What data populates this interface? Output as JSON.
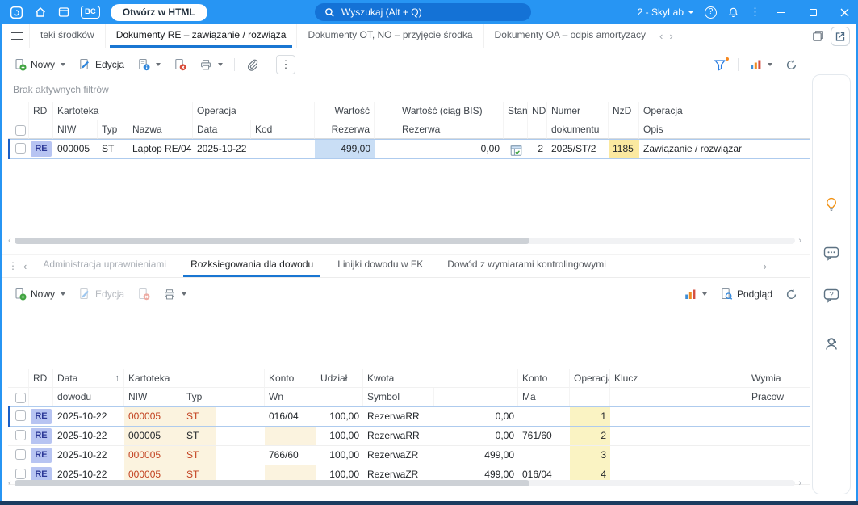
{
  "colors": {
    "titlebar": "#2795f3",
    "accent": "#1976d2",
    "re_badge_bg": "#b7c4f2",
    "re_badge_text": "#2b3796",
    "cell_highlight_blue": "#c9def5",
    "cell_highlight_yellow": "#fbe9a0",
    "cell_cream": "#fbf3df",
    "cell_op_yellow": "#faf3c3",
    "negative_red": "#c2401f",
    "filter_dot_orange": "#f6881f"
  },
  "icons": {
    "more_vertical": "⋮",
    "help": "?",
    "sort_asc": "↑",
    "chevron_left": "‹",
    "chevron_right": "›",
    "drag_handle": "⋮"
  },
  "titlebar": {
    "bc_label": "BC",
    "open_html_button": "Otwórz w HTML",
    "search_placeholder": "Wyszukaj (Alt + Q)",
    "user_menu": "2 - SkyLab"
  },
  "main_tabs": [
    {
      "label": "teki środków"
    },
    {
      "label": "Dokumenty RE – zawiązanie / rozwiąza"
    },
    {
      "label": "Dokumenty OT, NO – przyjęcie środka"
    },
    {
      "label": "Dokumenty OA – odpis amortyzacy"
    }
  ],
  "toolbar_top": {
    "new": "Nowy",
    "edit": "Edycja",
    "filter_status": "Brak aktywnych filtrów"
  },
  "grid1": {
    "headers": {
      "rd": "RD",
      "kartoteka": "Kartoteka",
      "operacja": "Operacja",
      "wartosc": "Wartość",
      "wartosc_bis": "Wartość (ciąg BIS)",
      "stan": "Stan",
      "nd": "ND",
      "numer": "Numer",
      "nzd": "NzD",
      "operacja2": "Operacja",
      "niw": "NIW",
      "typ": "Typ",
      "nazwa": "Nazwa",
      "data": "Data",
      "kod": "Kod",
      "rezerwa": "Rezerwa",
      "rezerwa_bis": "Rezerwa",
      "dokumentu": "dokumentu",
      "opis": "Opis"
    },
    "rows": [
      {
        "rd": "RE",
        "niw": "000005",
        "typ": "ST",
        "nazwa": "Laptop RE/04",
        "data": "2025-10-22",
        "kod": "",
        "rezerwa": "499,00",
        "rezerwa_bis": "0,00",
        "nd": "2",
        "numer": "2025/ST/2",
        "nzd": "1185",
        "opis": "Zawiązanie / rozwiązar"
      }
    ]
  },
  "panel_tabs": [
    {
      "label": "Administracja uprawnieniami"
    },
    {
      "label": "Rozksiegowania dla dowodu"
    },
    {
      "label": "Linijki dowodu w FK"
    },
    {
      "label": "Dowód z wymiarami kontrolingowymi"
    }
  ],
  "toolbar_bottom": {
    "new": "Nowy",
    "edit": "Edycja",
    "preview": "Podgląd"
  },
  "grid2": {
    "headers": {
      "rd": "RD",
      "data": "Data",
      "dowodu": "dowodu",
      "kartoteka": "Kartoteka",
      "niw": "NIW",
      "typ": "Typ",
      "konto1": "Konto",
      "wn": "Wn",
      "udzial": "Udział",
      "kwota": "Kwota",
      "symbol": "Symbol",
      "konto2": "Konto",
      "ma": "Ma",
      "operacja": "Operacja",
      "klucz": "Klucz",
      "wymiar": "Wymia",
      "pracownik": "Pracow"
    },
    "rows": [
      {
        "rd": "RE",
        "data": "2025-10-22",
        "niw": "000005",
        "typ": "ST",
        "konto_wn": "016/04",
        "udzial": "100,00",
        "symbol": "RezerwaRR",
        "kwota": "0,00",
        "konto_ma": "",
        "operacja": "1"
      },
      {
        "rd": "RE",
        "data": "2025-10-22",
        "niw": "000005",
        "typ": "ST",
        "konto_wn": "",
        "udzial": "100,00",
        "symbol": "RezerwaRR",
        "kwota": "0,00",
        "konto_ma": "761/60",
        "operacja": "2"
      },
      {
        "rd": "RE",
        "data": "2025-10-22",
        "niw": "000005",
        "typ": "ST",
        "konto_wn": "766/60",
        "udzial": "100,00",
        "symbol": "RezerwaZR",
        "kwota": "499,00",
        "konto_ma": "",
        "operacja": "3"
      },
      {
        "rd": "RE",
        "data": "2025-10-22",
        "niw": "000005",
        "typ": "ST",
        "konto_wn": "",
        "udzial": "100,00",
        "symbol": "RezerwaZR",
        "kwota": "499,00",
        "konto_ma": "016/04",
        "operacja": "4"
      }
    ]
  }
}
